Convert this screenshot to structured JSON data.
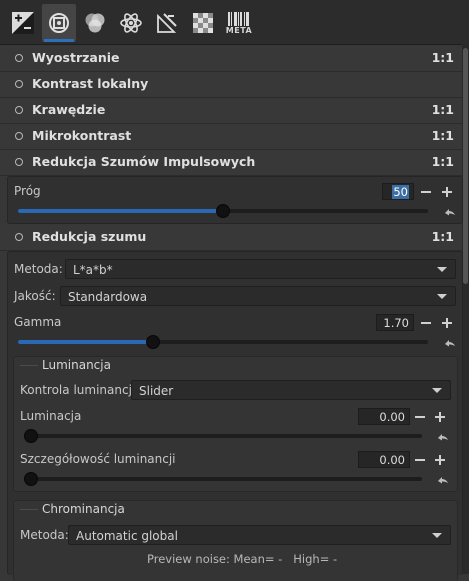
{
  "toolbar": {
    "tools": [
      "exposure-icon",
      "detail-icon",
      "color-icon",
      "advanced-icon",
      "transform-icon",
      "raw-icon",
      "meta-icon"
    ],
    "meta_label": "META"
  },
  "accent_color": "#2a67b5",
  "sections": {
    "sharpening": {
      "title": "Wyostrzanie",
      "ratio": "1:1"
    },
    "local_contrast": {
      "title": "Kontrast lokalny",
      "ratio": ""
    },
    "edges": {
      "title": "Krawędzie",
      "ratio": "1:1"
    },
    "microcontrast": {
      "title": "Mikrokontrast",
      "ratio": "1:1"
    },
    "impulse_nr": {
      "title": "Redukcja Szumów Impulsowych",
      "ratio": "1:1",
      "threshold": {
        "label": "Próg",
        "value": "50",
        "level": 0.5
      }
    },
    "noise_reduction": {
      "title": "Redukcja szumu",
      "ratio": "1:1",
      "method": {
        "label": "Metoda:",
        "value": "L*a*b*"
      },
      "quality": {
        "label": "Jakość:",
        "value": "Standardowa"
      },
      "gamma": {
        "label": "Gamma",
        "value": "1.70",
        "level": 0.33
      },
      "luminance": {
        "title": "Luminancja",
        "control": {
          "label": "Kontrola luminancji:",
          "value": "Slider"
        },
        "luminance": {
          "label": "Luminacja",
          "value": "0.00",
          "level": 0
        },
        "detail": {
          "label": "Szczegółowość luminancji",
          "value": "0.00",
          "level": 0
        }
      },
      "chrominance": {
        "title": "Chrominancja",
        "method": {
          "label": "Metoda:",
          "value": "Automatic global"
        },
        "preview": "Preview noise: Mean= -   High= -"
      }
    }
  }
}
